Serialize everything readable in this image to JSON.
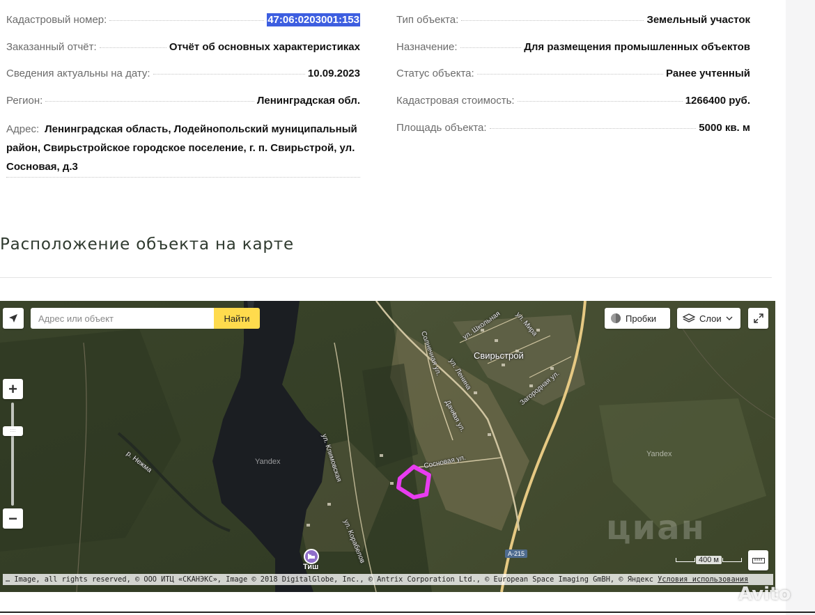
{
  "info": {
    "cadastral_number": {
      "label": "Кадастровый номер:",
      "value": "47:06:0203001:153"
    },
    "ordered_report": {
      "label": "Заказанный отчёт:",
      "value": "Отчёт об основных характеристиках"
    },
    "data_actual_date": {
      "label": "Сведения актуальны на дату:",
      "value": "10.09.2023"
    },
    "region": {
      "label": "Регион:",
      "value": "Ленинградская обл."
    },
    "address": {
      "label": "Адрес:",
      "value": "Ленинградская область, Лодейнопольский муниципальный район, Свирьстройское городское поселение, г. п. Свирьстрой, ул. Сосновая, д.3"
    },
    "object_type": {
      "label": "Тип объекта:",
      "value": "Земельный участок"
    },
    "purpose": {
      "label": "Назначение:",
      "value": "Для размещения промышленных объектов"
    },
    "object_status": {
      "label": "Статус объекта:",
      "value": "Ранее учтенный"
    },
    "cadastral_value": {
      "label": "Кадастровая стоимость:",
      "value": "1266400 руб."
    },
    "area": {
      "label": "Площадь объекта:",
      "value": "5000 кв. м"
    }
  },
  "section_title": "Расположение объекта на карте",
  "map": {
    "search_placeholder": "Адрес или объект",
    "find_label": "Найти",
    "traffic_label": "Пробки",
    "layers_label": "Слои",
    "labels": {
      "town": "Свирьстрой",
      "river": "р. Нежма",
      "yandex_1": "Yandex",
      "yandex_2": "Yandex",
      "street_sosnovaya": "Сосновая ул.",
      "street_lenina": "ул. Ленина",
      "street_dachnaya": "Дачная ул.",
      "street_solnechnaya": "Солнечная ул.",
      "street_zagorodnaya": "Загородная ул.",
      "street_shkolnaya": "ул. Школьная",
      "street_mira": "ул. Мира",
      "street_klimovskaya": "ул. Климовская",
      "street_korablestroiteley": "ул. Корабелов",
      "poi": "Тиш"
    },
    "road_badge": "A-215",
    "scale_label": "400 м",
    "copyright": "… Image, all rights reserved, © ООО ИТЦ «СКАНЭКС», Image © 2018 DigitalGlobe, Inc., © Antrix Corporation Ltd., © European Space Imaging GmBH, © Яндекс",
    "terms_label": "Условия использования",
    "plot_color": "#e83cf0"
  },
  "watermarks": {
    "avito": "Avito",
    "cian": "циан"
  }
}
